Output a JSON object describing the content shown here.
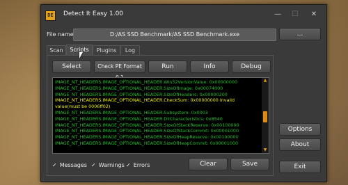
{
  "window": {
    "title": "Detect It Easy 1.00",
    "icon_glyph": "DE",
    "controls": {
      "minimize": "—",
      "maximize": "☐",
      "close": "✕"
    }
  },
  "file": {
    "label": "File name:",
    "value": "D:/AS SSD Benchmark/AS SSD Benchmark.exe",
    "browse_label": "..."
  },
  "tabs": [
    {
      "label": "Scan",
      "active": false
    },
    {
      "label": "Scripts",
      "active": true
    },
    {
      "label": "Plugins",
      "active": false
    },
    {
      "label": "Log",
      "active": false
    }
  ],
  "toolbar": {
    "select": "Select",
    "script_name": "Check PE Format 0.1",
    "run": "Run",
    "info": "Info",
    "debug": "Debug"
  },
  "log": {
    "lines": [
      {
        "text": "IMAGE_NT_HEADERS.IMAGE_OPTIONAL_HEADER.Win32VersionValue: 0x00000000",
        "highlight": false
      },
      {
        "text": "IMAGE_NT_HEADERS.IMAGE_OPTIONAL_HEADER.SizeOfImage: 0x00074000",
        "highlight": false
      },
      {
        "text": "IMAGE_NT_HEADERS.IMAGE_OPTIONAL_HEADER.SizeOfHeaders: 0x00000200",
        "highlight": false
      },
      {
        "text": "IMAGE_NT_HEADERS.IMAGE_OPTIONAL_HEADER.CheckSum: 0x00000000 Invalid value(must be 0006ff02)",
        "highlight": true
      },
      {
        "text": "IMAGE_NT_HEADERS.IMAGE_OPTIONAL_HEADER.Subsystem: 0x0003",
        "highlight": false
      },
      {
        "text": "IMAGE_NT_HEADERS.IMAGE_OPTIONAL_HEADER.DllCharacteristics: 0x8540",
        "highlight": false
      },
      {
        "text": "IMAGE_NT_HEADERS.IMAGE_OPTIONAL_HEADER.SizeOfStackReserve: 0x00100000",
        "highlight": false
      },
      {
        "text": "IMAGE_NT_HEADERS.IMAGE_OPTIONAL_HEADER.SizeOfStackCommit: 0x00001000",
        "highlight": false
      },
      {
        "text": "IMAGE_NT_HEADERS.IMAGE_OPTIONAL_HEADER.SizeOfHeapReserve: 0x00100000",
        "highlight": false
      },
      {
        "text": "IMAGE_NT_HEADERS.IMAGE_OPTIONAL_HEADER.SizeOfHeapCommit: 0x00001000",
        "highlight": false
      }
    ],
    "normal_color": "#1fbf2a",
    "highlight_color": "#f0f000",
    "scroll_up": "▲",
    "scroll_down": "▼"
  },
  "filters": {
    "messages": {
      "label": "Messages",
      "checked": true
    },
    "warnings": {
      "label": "Warnings",
      "checked": true
    },
    "errors": {
      "label": "Errors",
      "checked": true
    },
    "check_glyph": "✓"
  },
  "bottom_buttons": {
    "clear": "Clear",
    "save": "Save"
  },
  "side_buttons": {
    "options": "Options",
    "about": "About",
    "exit": "Exit"
  }
}
